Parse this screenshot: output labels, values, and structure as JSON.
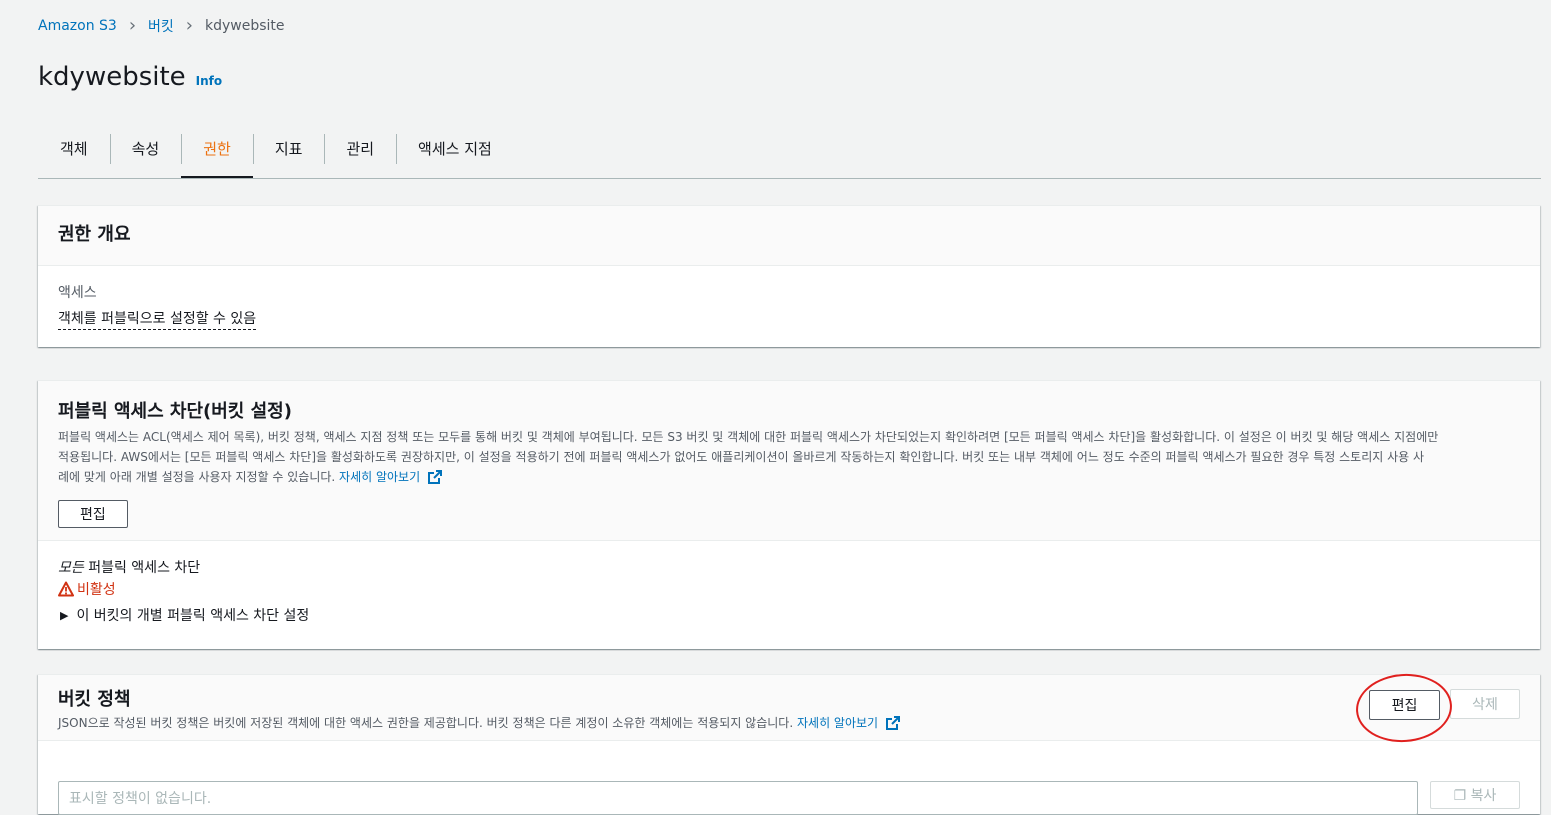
{
  "breadcrumb": {
    "root": "Amazon S3",
    "buckets": "버킷",
    "current": "kdywebsite"
  },
  "page": {
    "title": "kdywebsite",
    "info": "Info"
  },
  "tabs": [
    {
      "label": "객체"
    },
    {
      "label": "속성"
    },
    {
      "label": "권한"
    },
    {
      "label": "지표"
    },
    {
      "label": "관리"
    },
    {
      "label": "액세스 지점"
    }
  ],
  "overview": {
    "title": "권한 개요",
    "access_label": "액세스",
    "access_value": "객체를 퍼블릭으로 설정할 수 있음"
  },
  "block_public": {
    "title": "퍼블릭 액세스 차단(버킷 설정)",
    "desc1": "퍼블릭 액세스는 ACL(액세스 제어 목록), 버킷 정책, 액세스 지점 정책 또는 모두를 통해 버킷 및 객체에 부여됩니다. 모든 S3 버킷 및 객체에 대한 퍼블릭 액세스가 차단되었는지 확인하려면 [모든 퍼블릭 액세스 차단]을 활성화합니다. 이 설정은 이 버킷 및 해당 액세스 지점에만",
    "desc2": "적용됩니다. AWS에서는 [모든 퍼블릭 액세스 차단]을 활성화하도록 권장하지만, 이 설정을 적용하기 전에 퍼블릭 액세스가 없어도 애플리케이션이 올바르게 작동하는지 확인합니다. 버킷 또는 내부 객체에 어느 정도 수준의 퍼블릭 액세스가 필요한 경우 특정 스토리지 사용 사",
    "desc3": "례에 맞게 아래 개별 설정을 사용자 지정할 수 있습니다.",
    "learn_more": "자세히 알아보기",
    "edit_label": "편집",
    "all_prefix": "모든",
    "all_suffix": " 퍼블릭 액세스 차단",
    "status": "비활성",
    "expander": "이 버킷의 개별 퍼블릭 액세스 차단 설정"
  },
  "bucket_policy": {
    "title": "버킷 정책",
    "desc": "JSON으로 작성된 버킷 정책은 버킷에 저장된 객체에 대한 액세스 권한을 제공합니다. 버킷 정책은 다른 계정이 소유한 객체에는 적용되지 않습니다.",
    "learn_more": "자세히 알아보기",
    "edit_label": "편집",
    "delete_label": "삭제",
    "empty_text": "표시할 정책이 없습니다.",
    "copy_label": "복사"
  },
  "colors": {
    "accent": "#ec7211",
    "link": "#0073bb",
    "warning": "#d13212",
    "annotation": "#e0201e"
  }
}
